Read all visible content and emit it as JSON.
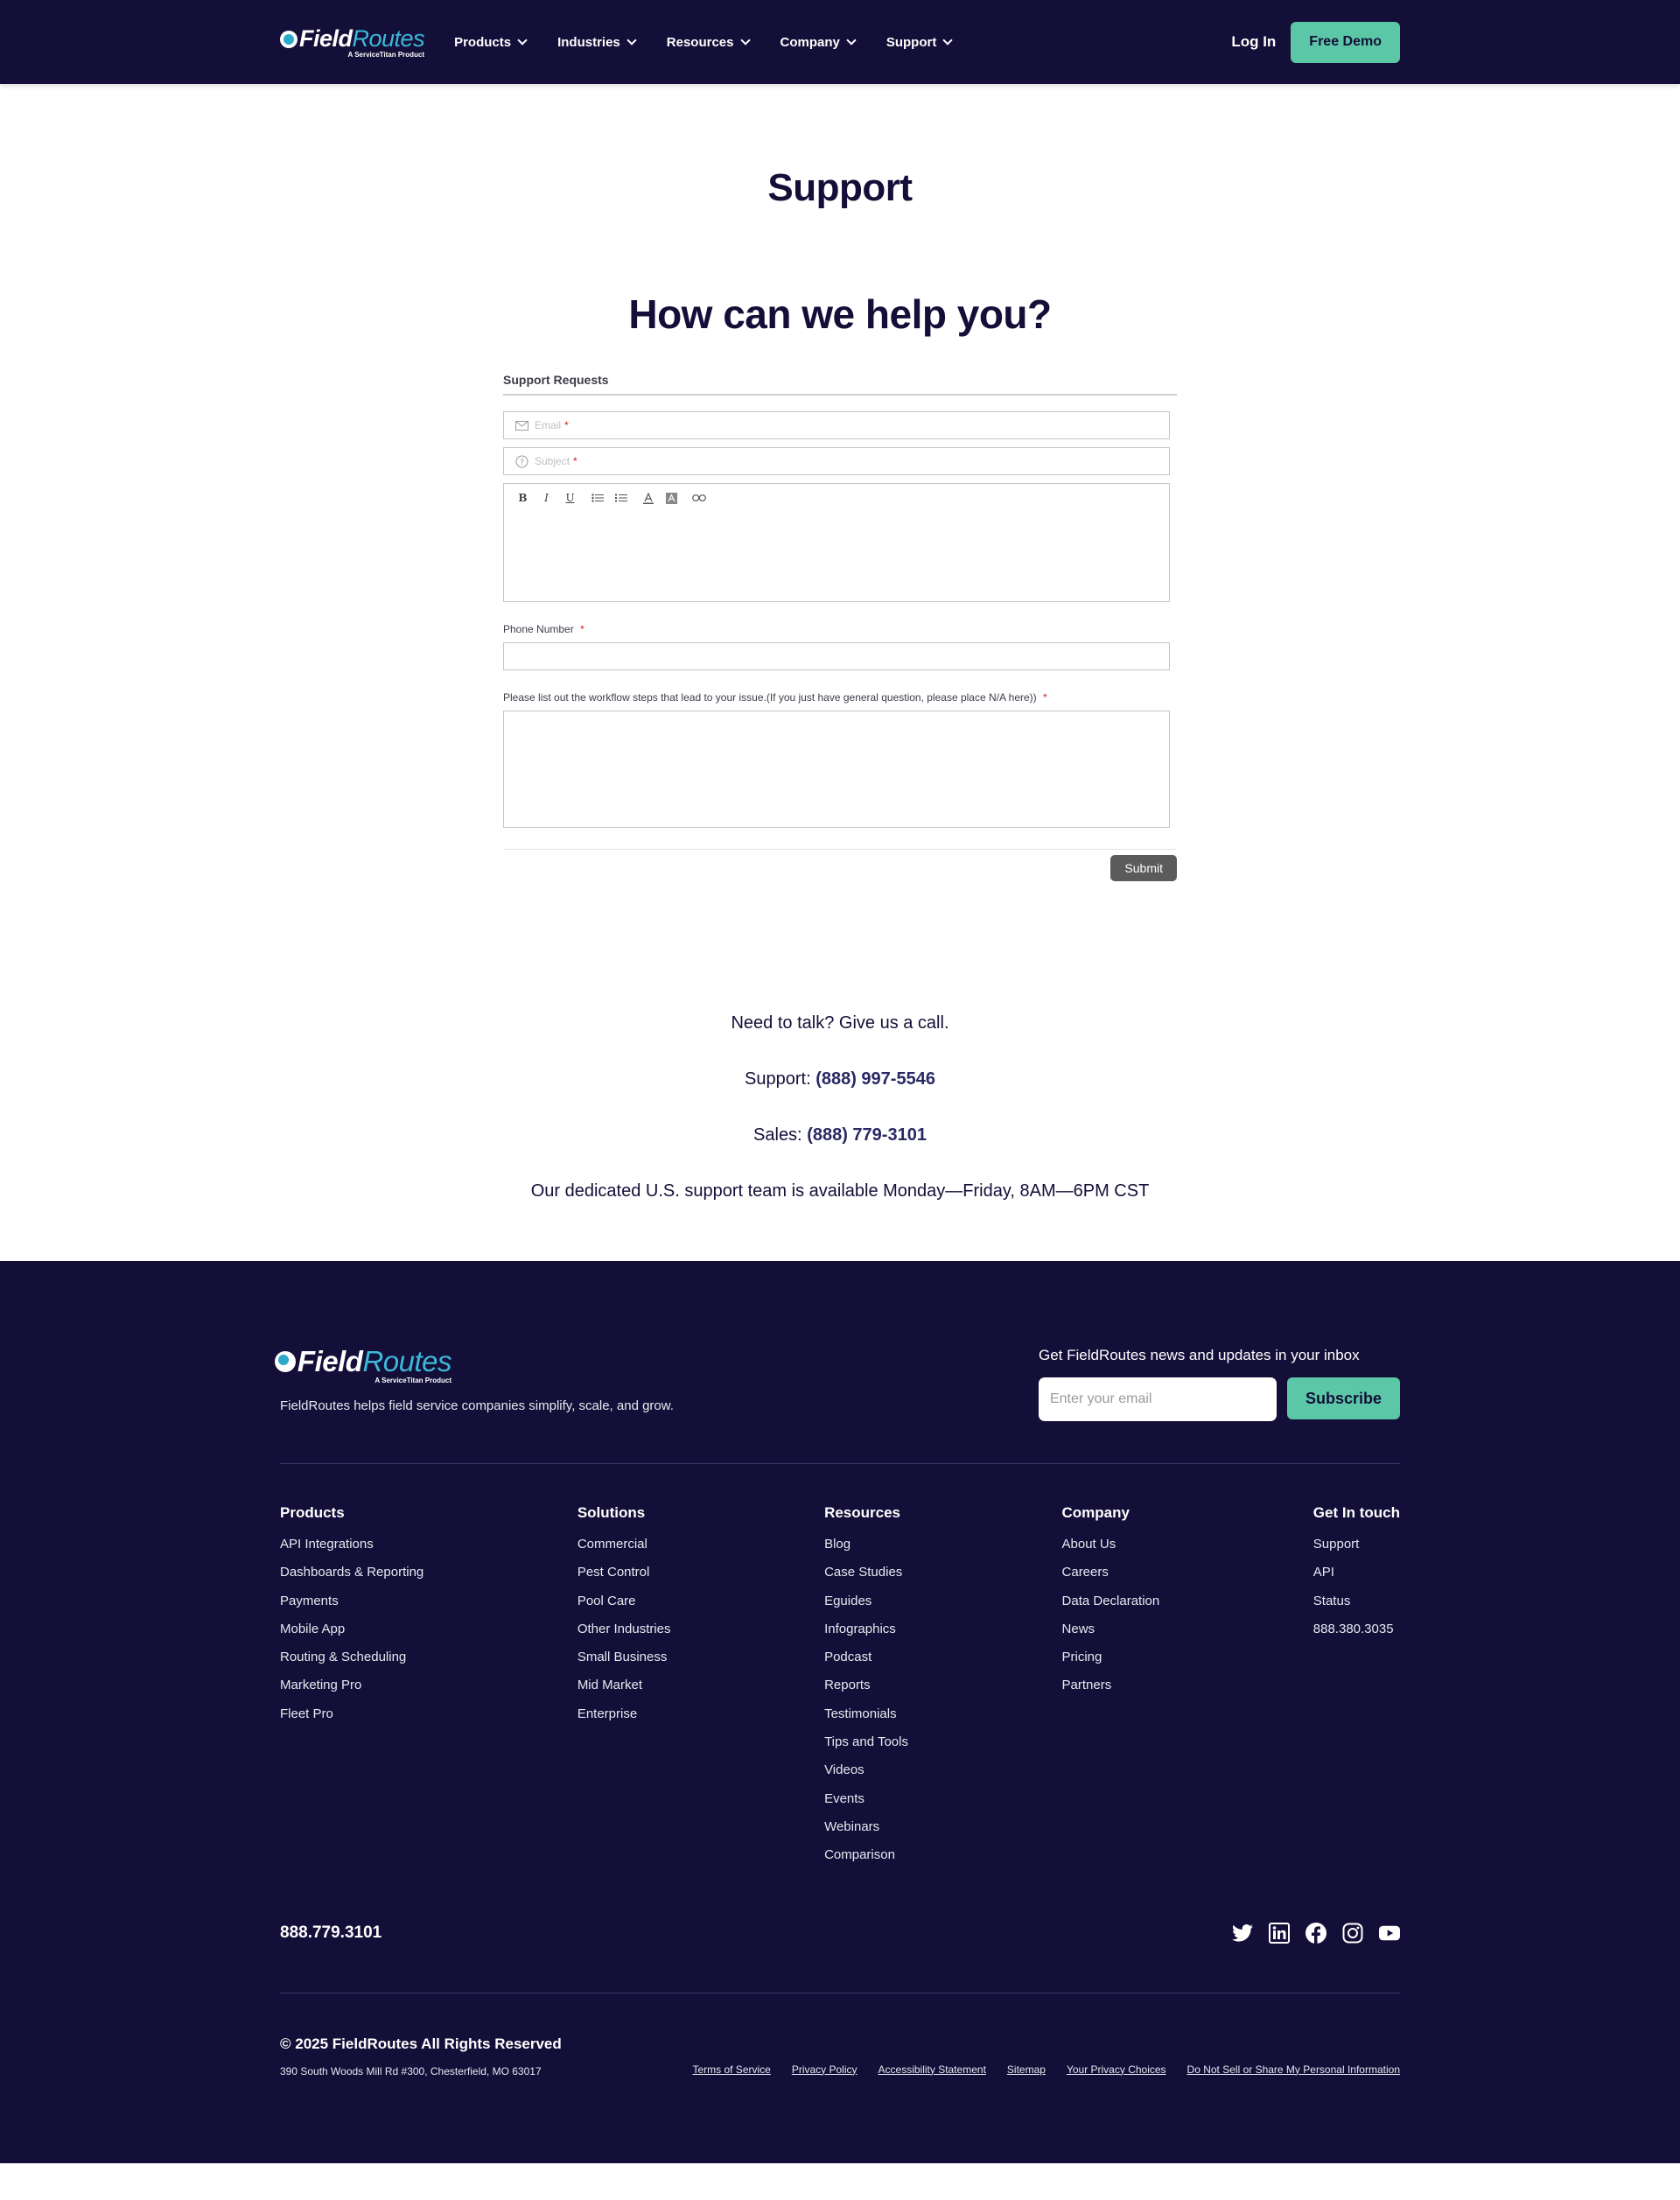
{
  "header": {
    "logo": {
      "field": "Field",
      "routes": "Routes",
      "sub": "A ServiceTitan Product"
    },
    "nav": [
      "Products",
      "Industries",
      "Resources",
      "Company",
      "Support"
    ],
    "login": "Log In",
    "demo": "Free Demo"
  },
  "main": {
    "title": "Support",
    "subtitle": "How can we help you?"
  },
  "form": {
    "title": "Support Requests",
    "email_placeholder": "Email",
    "subject_placeholder": "Subject",
    "phone_label": "Phone Number",
    "workflow_label": "Please list out the workflow steps that lead to your issue.(If you just have general question, please place N/A here))",
    "required_mark": "*",
    "toolbar": [
      "B",
      "I",
      "U"
    ],
    "submit": "Submit"
  },
  "contact": {
    "call": "Need to talk? Give us a call.",
    "support_label": "Support:",
    "support_phone": "(888) 997-5546",
    "sales_label": "Sales:",
    "sales_phone": "(888) 779-3101",
    "hours": "Our dedicated U.S. support team is available Monday—Friday, 8AM—6PM CST"
  },
  "footer": {
    "tagline": "FieldRoutes helps field service companies simplify, scale, and grow.",
    "news_title": "Get FieldRoutes news and updates in your inbox",
    "email_placeholder": "Enter your email",
    "subscribe": "Subscribe",
    "columns": [
      {
        "title": "Products",
        "links": [
          "API Integrations",
          "Dashboards & Reporting",
          "Payments",
          "Mobile App",
          "Routing & Scheduling",
          "Marketing Pro",
          "Fleet Pro"
        ]
      },
      {
        "title": "Solutions",
        "links": [
          "Commercial",
          "Pest Control",
          "Pool Care",
          "Other Industries",
          "Small Business",
          "Mid Market",
          "Enterprise"
        ]
      },
      {
        "title": "Resources",
        "links": [
          "Blog",
          "Case Studies",
          "Eguides",
          "Infographics",
          "Podcast",
          "Reports",
          "Testimonials",
          "Tips and Tools",
          "Videos",
          "Events",
          "Webinars",
          "Comparison"
        ]
      },
      {
        "title": "Company",
        "links": [
          "About Us",
          "Careers",
          "Data Declaration",
          "News",
          "Pricing",
          "Partners"
        ]
      },
      {
        "title": "Get In touch",
        "links": [
          "Support",
          "API",
          "Status",
          "888.380.3035"
        ]
      }
    ],
    "phone": "888.779.3101",
    "socials": [
      "twitter-icon",
      "linkedin-icon",
      "facebook-icon",
      "instagram-icon",
      "youtube-icon"
    ],
    "copyright": "© 2025 FieldRoutes All Rights Reserved",
    "address": "390 South Woods Mill Rd #300, Chesterfield, MO 63017",
    "legal": [
      "Terms of Service",
      "Privacy Policy",
      "Accessibility Statement",
      "Sitemap",
      "Your Privacy Choices",
      "Do Not Sell or Share My Personal Information"
    ]
  },
  "colors": {
    "navy": "#130f38",
    "accent": "#5cc7a6",
    "logo_blue": "#3cb8d8"
  }
}
